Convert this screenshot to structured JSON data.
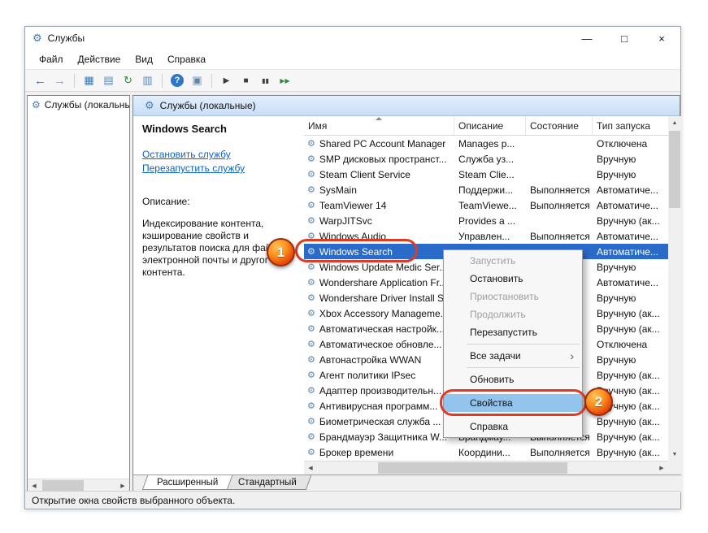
{
  "window": {
    "title": "Службы",
    "status_bar": "Открытие окна свойств выбранного объекта.",
    "controls": {
      "minimize": "—",
      "maximize": "□",
      "close": "×"
    }
  },
  "menu_bar": [
    "Файл",
    "Действие",
    "Вид",
    "Справка"
  ],
  "toolbar": [
    {
      "name": "back",
      "glyph": "←",
      "color": "#2a6bc9",
      "size": 15
    },
    {
      "name": "forward",
      "glyph": "→",
      "color": "#84aad6",
      "size": 15
    },
    {
      "sep": true
    },
    {
      "name": "show-console-tree",
      "glyph": "▦",
      "color": "#3f76b0",
      "size": 13
    },
    {
      "name": "export-list",
      "glyph": "▤",
      "color": "#5f87ae",
      "size": 13
    },
    {
      "name": "refresh",
      "glyph": "↻",
      "color": "#2d8a3e",
      "size": 13
    },
    {
      "name": "export",
      "glyph": "▥",
      "color": "#5f87ae",
      "size": 13
    },
    {
      "sep": true
    },
    {
      "name": "help",
      "glyph": "?",
      "color": "#ffffff",
      "size": 11
    },
    {
      "name": "properties-window",
      "glyph": "▣",
      "color": "#5f87ae",
      "size": 13
    },
    {
      "sep": true
    },
    {
      "name": "start-service",
      "glyph": "▶",
      "color": "#3d3d3d",
      "size": 10
    },
    {
      "name": "stop-service",
      "glyph": "■",
      "color": "#3d3d3d",
      "size": 10
    },
    {
      "name": "pause-service",
      "glyph": "▮▮",
      "color": "#3d3d3d",
      "size": 8
    },
    {
      "name": "restart-service",
      "glyph": "▶▶",
      "color": "#2d8a3e",
      "size": 8
    }
  ],
  "icons": {
    "gear": "⚙",
    "up": "▲",
    "down": "▼",
    "left": "◀",
    "right": "▶",
    "submenu": "›"
  },
  "tree": {
    "root_label": "Службы (локальны"
  },
  "result_pane": {
    "header": "Службы (локальные)",
    "info": {
      "selected_service": "Windows Search",
      "links": [
        "Остановить службу",
        "Перезапустить службу"
      ],
      "description_label": "Описание:",
      "description_lines": [
        "Индексирование контента,",
        "кэширование свойств и",
        "результатов поиска для файл",
        "электронной почты и другог",
        "контента."
      ]
    },
    "table": {
      "columns": [
        "Имя",
        "Описание",
        "Состояние",
        "Тип запуска"
      ],
      "rows": [
        {
          "name": "Shared PC Account Manager",
          "description": "Manages p...",
          "status": "",
          "startup": "Отключена",
          "selected": false
        },
        {
          "name": "SMP дисковых пространст...",
          "description": "Служба уз...",
          "status": "",
          "startup": "Вручную",
          "selected": false
        },
        {
          "name": "Steam Client Service",
          "description": "Steam Clie...",
          "status": "",
          "startup": "Вручную",
          "selected": false
        },
        {
          "name": "SysMain",
          "description": "Поддержи...",
          "status": "Выполняется",
          "startup": "Автоматиче...",
          "selected": false
        },
        {
          "name": "TeamViewer 14",
          "description": "TeamViewe...",
          "status": "Выполняется",
          "startup": "Автоматиче...",
          "selected": false
        },
        {
          "name": "WarpJITSvc",
          "description": "Provides a ...",
          "status": "",
          "startup": "Вручную (ак...",
          "selected": false
        },
        {
          "name": "Windows Audio",
          "description": "Управлен...",
          "status": "Выполняется",
          "startup": "Автоматиче...",
          "selected": false
        },
        {
          "name": "Windows Search",
          "description": "",
          "status": "",
          "startup": "Автоматиче...",
          "selected": true
        },
        {
          "name": "Windows Update Medic Ser...",
          "description": "",
          "status": "",
          "startup": "Вручную",
          "selected": false
        },
        {
          "name": "Wondershare Application Fr...",
          "description": "",
          "status": "",
          "startup": "Автоматиче...",
          "selected": false
        },
        {
          "name": "Wondershare Driver Install S...",
          "description": "",
          "status": "",
          "startup": "Вручную",
          "selected": false
        },
        {
          "name": "Xbox Accessory Manageme...",
          "description": "",
          "status": "",
          "startup": "Вручную (ак...",
          "selected": false
        },
        {
          "name": "Автоматическая настройк...",
          "description": "",
          "status": "",
          "startup": "Вручную (ак...",
          "selected": false
        },
        {
          "name": "Автоматическое обновле...",
          "description": "",
          "status": "",
          "startup": "Отключена",
          "selected": false
        },
        {
          "name": "Автонастройка WWAN",
          "description": "",
          "status": "",
          "startup": "Вручную",
          "selected": false
        },
        {
          "name": "Агент политики IPsec",
          "description": "",
          "status": "",
          "startup": "Вручную (ак...",
          "selected": false
        },
        {
          "name": "Адаптер производительн...",
          "description": "",
          "status": "",
          "startup": "Вручную (ак...",
          "selected": false
        },
        {
          "name": "Антивирусная программ...",
          "description": "",
          "status": "",
          "startup": "Вручную (ак...",
          "selected": false
        },
        {
          "name": "Биометрическая служба ...",
          "description": "",
          "status": "",
          "startup": "Вручную (ак...",
          "selected": false
        },
        {
          "name": "Брандмауэр Защитника W...",
          "description": "Брандмау...",
          "status": "Выполняется",
          "startup": "Вручную (ак...",
          "selected": false
        },
        {
          "name": "Брокер времени",
          "description": "Координи...",
          "status": "Выполняется",
          "startup": "Вручную (ак...",
          "selected": false
        }
      ]
    },
    "tabs": [
      {
        "label": "Расширенный",
        "active": true
      },
      {
        "label": "Стандартный",
        "active": false
      }
    ]
  },
  "context_menu": {
    "items": [
      {
        "id": "start",
        "label": "Запустить",
        "disabled": true
      },
      {
        "id": "stop",
        "label": "Остановить",
        "disabled": false
      },
      {
        "id": "pause",
        "label": "Приостановить",
        "disabled": true
      },
      {
        "id": "resume",
        "label": "Продолжить",
        "disabled": true
      },
      {
        "id": "restart",
        "label": "Перезапустить",
        "disabled": false
      },
      {
        "separator": true
      },
      {
        "id": "all-tasks",
        "label": "Все задачи",
        "disabled": false,
        "submenu": true
      },
      {
        "separator": true
      },
      {
        "id": "refresh",
        "label": "Обновить",
        "disabled": false
      },
      {
        "separator": true
      },
      {
        "id": "properties",
        "label": "Свойства",
        "disabled": false,
        "highlighted": true
      },
      {
        "separator": true
      },
      {
        "id": "help",
        "label": "Справка",
        "disabled": false
      }
    ]
  },
  "annotations": {
    "badge1": "1",
    "badge2": "2"
  },
  "colors": {
    "selection": "#2a6bc9",
    "annotation": "#e03a22",
    "link": "#0f62c5"
  }
}
